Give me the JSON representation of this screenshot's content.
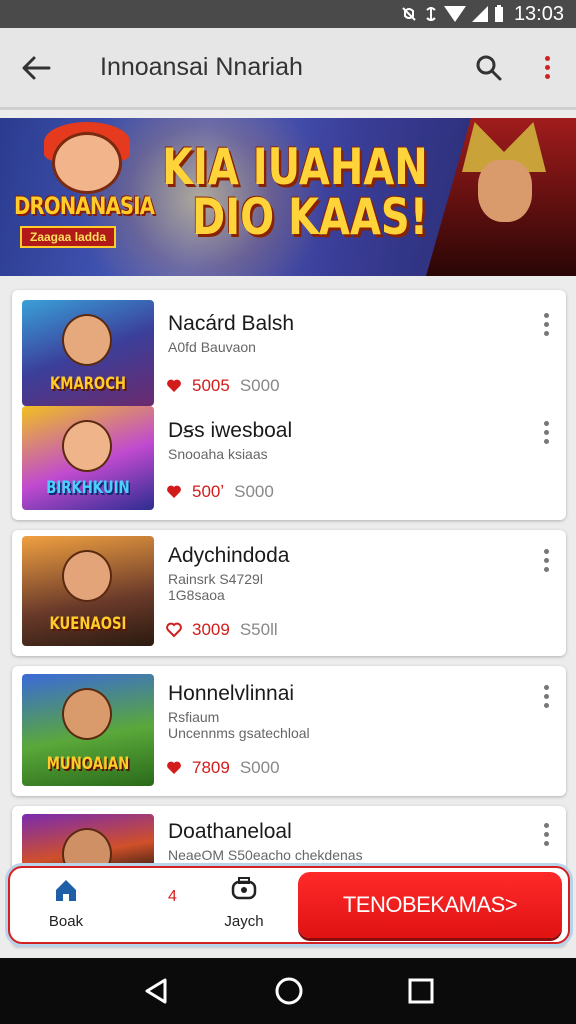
{
  "status_bar": {
    "time": "13:03",
    "icons": [
      "silent-icon",
      "no-data-icon",
      "wifi-icon",
      "signal-icon",
      "battery-icon"
    ]
  },
  "app_bar": {
    "title": "Innoansai Nnariah",
    "back_icon": "arrow-back-icon",
    "search_icon": "search-icon",
    "menu_icon": "more-vert-icon",
    "menu_color": "#d32020"
  },
  "banner": {
    "logo_text": "DRONANASIA",
    "logo_sub": "Zaagaa ladda",
    "headline_line1": "KIA IUAHAN",
    "headline_line2": "DIO KAAS!"
  },
  "items": [
    {
      "title": "Nacárd Balsh",
      "sub": "A0fd Bauvaon",
      "likes": "5005",
      "views": "S000",
      "thumb_label": "KMAROCH"
    },
    {
      "title": "Dꞩs iwesboal",
      "sub": "Snooaha ksiaas",
      "likes": "500ʼ",
      "views": "S000",
      "thumb_label": "BIRKHKUIN"
    },
    {
      "title": "Adychindoda",
      "sub1": "Rainsrk S4729l",
      "sub2": "1G8saoa",
      "likes": "3009",
      "views": "S50ll",
      "thumb_label": "KUENAOSI"
    },
    {
      "title": "Honnelvlinnai",
      "sub1": "Rsfiaum",
      "sub2": "Uncennms gsatechloal",
      "likes": "7809",
      "views": "S000",
      "thumb_label": "MUNOAIAN"
    },
    {
      "title": "Doathaneloal",
      "sub": "NeaeOM S50eacho chekdenas",
      "thumb_label": ""
    }
  ],
  "bottom_bar": {
    "home_label": "Boak",
    "badge": "4",
    "search_label": "Jaych",
    "cta_label": "TENOBEKAMAS>"
  },
  "colors": {
    "accent": "#d32020",
    "like": "#d21c1c"
  }
}
